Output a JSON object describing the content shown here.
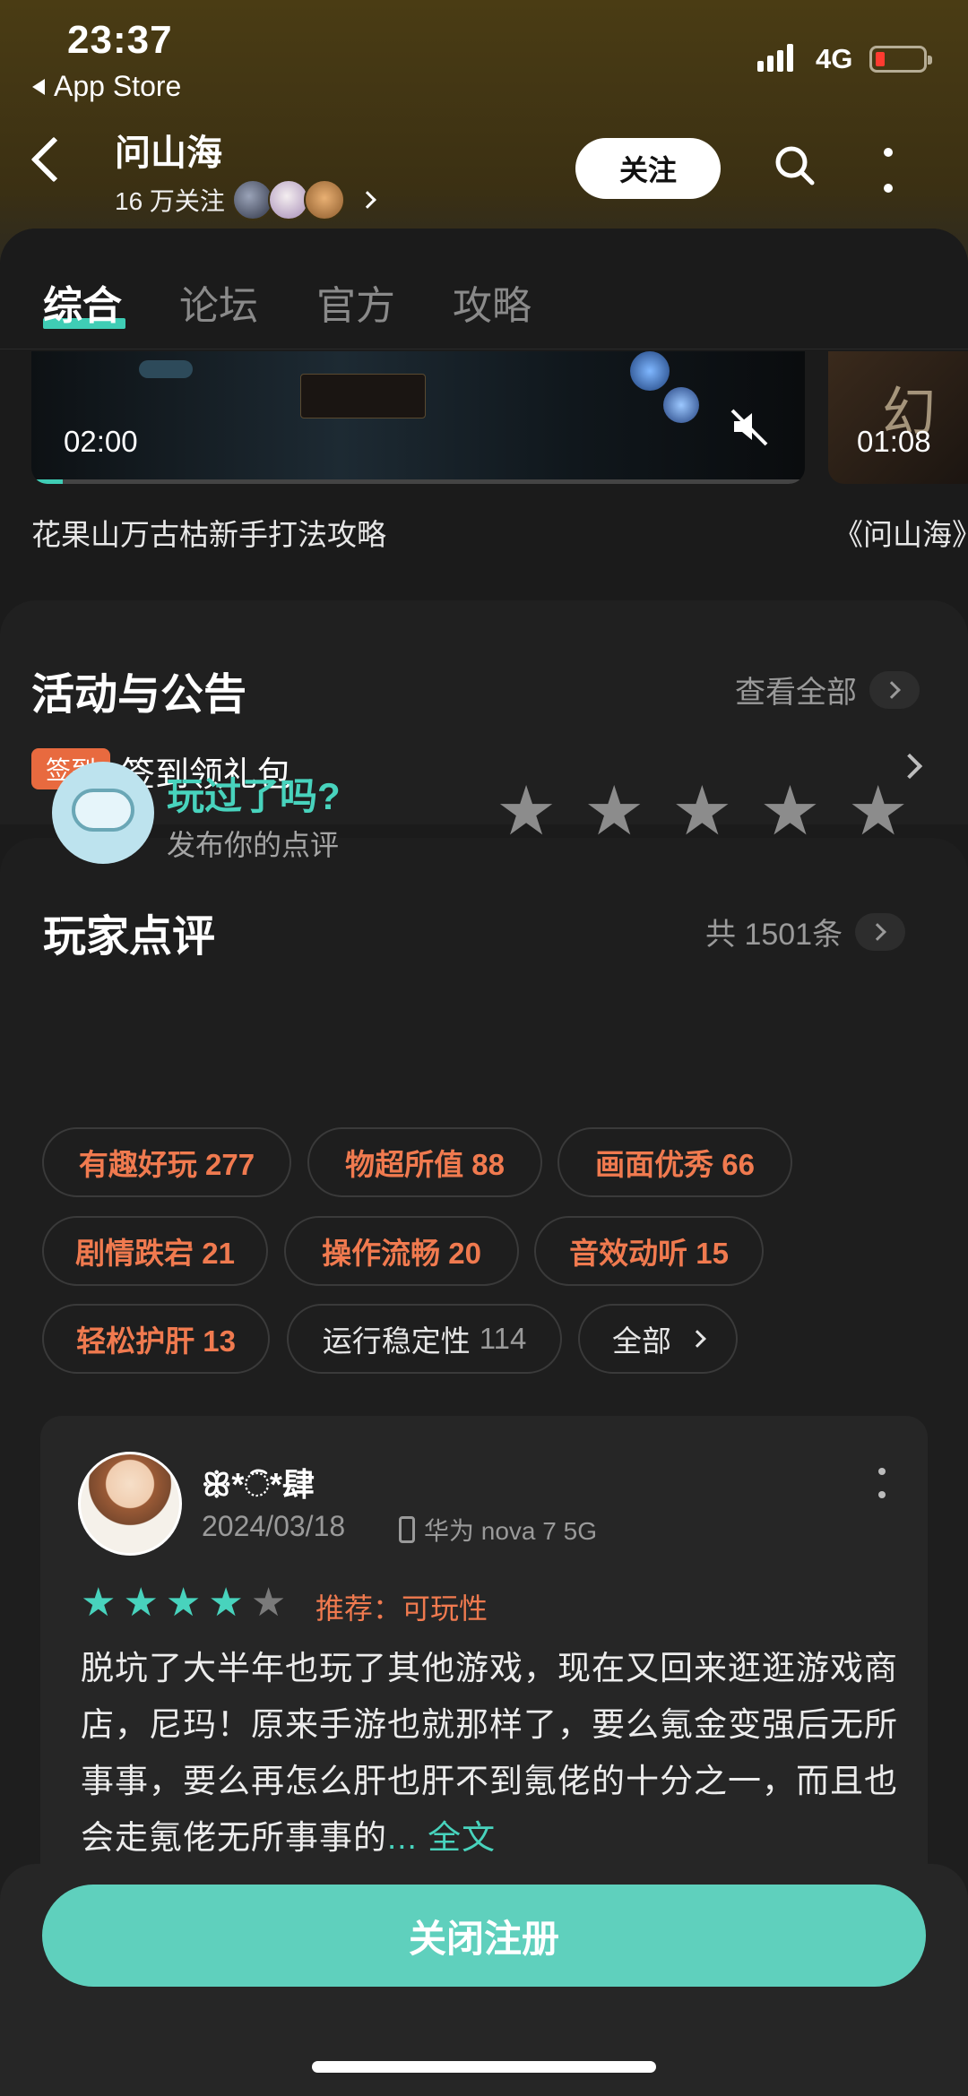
{
  "status_bar": {
    "time": "23:37",
    "back_app": "App Store",
    "network": "4G"
  },
  "header": {
    "title": "问山海",
    "followers": "16 万关注",
    "follow_label": "关注"
  },
  "tabs": [
    {
      "label": "综合"
    },
    {
      "label": "论坛"
    },
    {
      "label": "官方"
    },
    {
      "label": "攻略"
    }
  ],
  "videos": [
    {
      "duration": "02:00",
      "title": "花果山万古枯新手打法攻略"
    },
    {
      "duration": "01:08",
      "title": "《问山海》"
    }
  ],
  "events": {
    "title": "活动与公告",
    "view_all": "查看全部",
    "tag": "签到",
    "item": "签到领礼包"
  },
  "reviews": {
    "title": "玩家点评",
    "count_label": "共 1501条",
    "prompt_title": "玩过了吗?",
    "prompt_sub": "发布你的点评",
    "tags": [
      {
        "label": "有趣好玩 277"
      },
      {
        "label": "物超所值 88"
      },
      {
        "label": "画面优秀 66"
      },
      {
        "label": "剧情跌宕 21"
      },
      {
        "label": "操作流畅 20"
      },
      {
        "label": "音效动听 15"
      },
      {
        "label": "轻松护肝 13"
      },
      {
        "label": "运行稳定性",
        "count": "114"
      },
      {
        "label": "全部"
      }
    ],
    "card": {
      "username": "ꕥ*ି*肆",
      "date": "2024/03/18",
      "device": "华为 nova 7 5G",
      "rating": 4,
      "recommend": "推荐：可玩性",
      "body": "脱坑了大半年也玩了其他游戏，现在又回来逛逛游戏商店，尼玛！原来手游也就那样了，要么氪金变强后无所事事，要么再怎么肝也肝不到氪佬的十分之一，而且也会走氪佬无所事事的",
      "more_label": "... 全文"
    }
  },
  "bottom": {
    "close_label": "关闭注册"
  },
  "colors": {
    "accent": "#48d3bd",
    "tag_orange": "#f07a4f",
    "sign_tag": "#e86a3f"
  }
}
